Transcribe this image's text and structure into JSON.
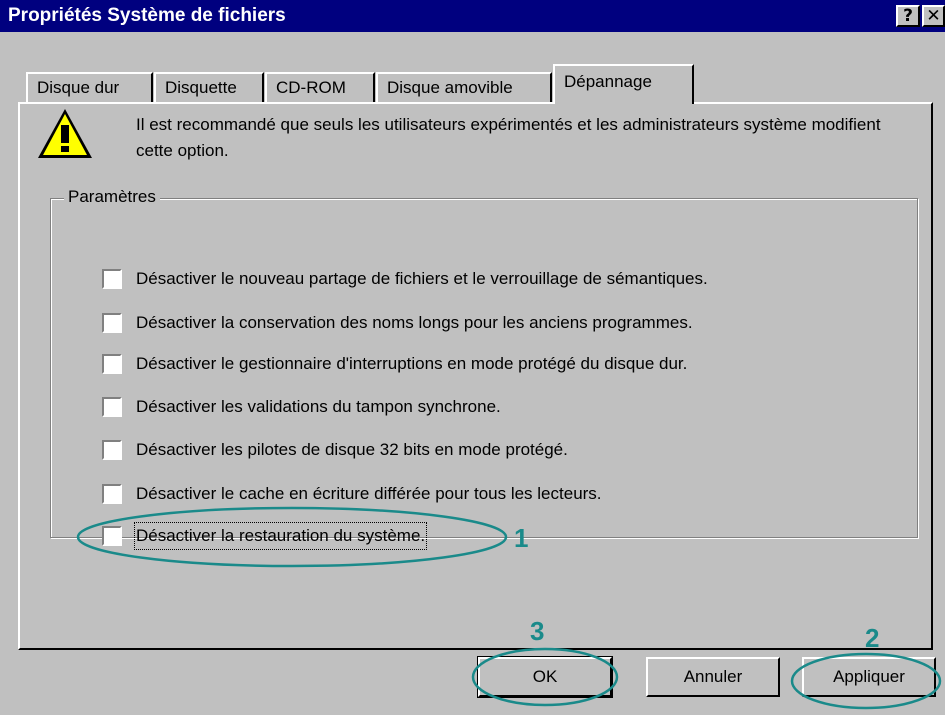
{
  "window": {
    "title": "Propriétés Système de fichiers",
    "help_glyph": "?",
    "close_glyph": "✕"
  },
  "tabs": [
    {
      "label": "Disque dur"
    },
    {
      "label": "Disquette"
    },
    {
      "label": "CD-ROM"
    },
    {
      "label": "Disque amovible"
    },
    {
      "label": "Dépannage",
      "active": true
    }
  ],
  "warning": {
    "icon": "warning-icon",
    "text": "Il est recommandé que seuls les utilisateurs expérimentés et les administrateurs système modifient cette option."
  },
  "parametres": {
    "legend": "Paramètres",
    "options": [
      {
        "label": "Désactiver le nouveau partage de fichiers et le verrouillage de sémantiques.",
        "checked": false
      },
      {
        "label": "Désactiver la conservation des noms longs pour les anciens programmes.",
        "checked": false
      },
      {
        "label": "Désactiver le gestionnaire d'interruptions en mode protégé du disque dur.",
        "checked": false
      },
      {
        "label": "Désactiver les validations du tampon synchrone.",
        "checked": false
      },
      {
        "label": "Désactiver les pilotes de disque 32 bits en mode protégé.",
        "checked": false
      },
      {
        "label": "Désactiver le cache en écriture différée pour tous les lecteurs.",
        "checked": false
      },
      {
        "label": "Désactiver la restauration du système.",
        "checked": false
      }
    ]
  },
  "buttons": {
    "ok": "OK",
    "cancel": "Annuler",
    "apply": "Appliquer"
  },
  "annotations": {
    "marker_1": "1",
    "marker_2": "2",
    "marker_3": "3",
    "color": "#1a8a8a"
  }
}
